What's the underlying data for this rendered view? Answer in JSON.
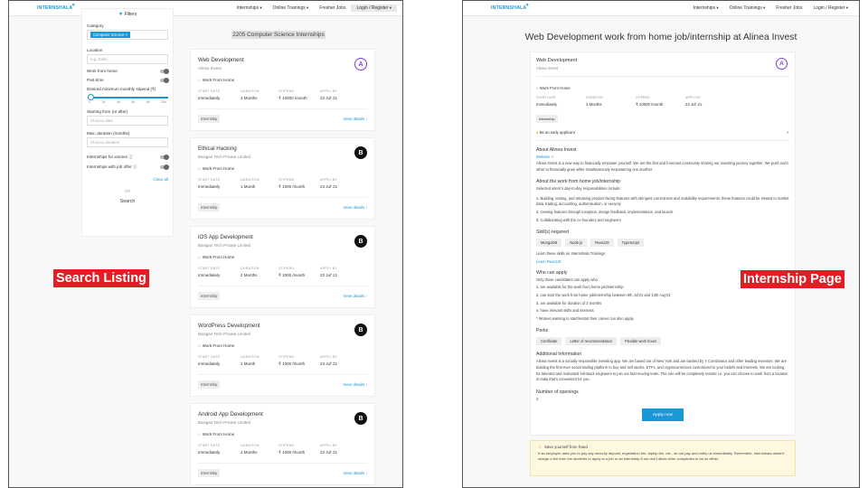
{
  "nav": {
    "logo": "INTERNSHALA",
    "items": [
      "Internships",
      "Online Trainings",
      "Fresher Jobs",
      "Login / Register"
    ]
  },
  "filters": {
    "title": "Filters",
    "category_label": "Category",
    "category_chip": "Computer Science",
    "location_label": "Location",
    "location_placeholder": "e.g. Delhi",
    "wfh": "Work from home",
    "parttime": "Part-time",
    "stipend_label": "Desired minimum monthly stipend (₹)",
    "ticks": [
      "0",
      "2k",
      "4k",
      "6k",
      "8k",
      "10k"
    ],
    "starting_label": "Starting from (or after)",
    "starting_placeholder": "Choose date",
    "duration_label": "Max. duration (months)",
    "duration_placeholder": "Choose duration",
    "women": "Internships for women",
    "joboffer": "Internships with job offer",
    "clear": "Clear all",
    "or": "OR",
    "search": "Search"
  },
  "listing": {
    "header": "2205 Computer Science Internships",
    "meta_heads": [
      "START DATE",
      "DURATION",
      "STIPEND",
      "APPLY BY"
    ],
    "wfh": "Work From Home",
    "tag": "Internship",
    "view": "View details",
    "cards": [
      {
        "title": "Web Development",
        "company": "Alinea Invest",
        "logo": "A",
        "start": "Immediately",
        "duration": "3 Months",
        "stipend": "₹ 10000 /month",
        "apply": "23 Jul' 21"
      },
      {
        "title": "Ethical Hacking",
        "company": "Basigan Tech Private Limited",
        "logo": "B",
        "start": "Immediately",
        "duration": "1 Month",
        "stipend": "₹ 1000 /month",
        "apply": "23 Jul' 21"
      },
      {
        "title": "iOS App Development",
        "company": "Basigan Tech Private Limited",
        "logo": "B",
        "start": "Immediately",
        "duration": "2 Months",
        "stipend": "₹ 1000 /month",
        "apply": "23 Jul' 21"
      },
      {
        "title": "WordPress Development",
        "company": "Basigan Tech Private Limited",
        "logo": "B",
        "start": "Immediately",
        "duration": "1 Month",
        "stipend": "₹ 1000 /month",
        "apply": "23 Jul' 21"
      },
      {
        "title": "Android App Development",
        "company": "Basigan Tech Private Limited",
        "logo": "B",
        "start": "Immediately",
        "duration": "2 Months",
        "stipend": "₹ 1000 /month",
        "apply": "23 Jul' 21"
      }
    ]
  },
  "labels": {
    "left": "Search Listing",
    "right": "Internship Page"
  },
  "detail": {
    "page_title": "Web Development work from home job/internship at Alinea Invest",
    "job_title": "Web Development",
    "company": "Alinea Invest",
    "logo": "A",
    "wfh": "Work From Home",
    "start": "Immediately",
    "duration": "3 Months",
    "stipend": "₹ 10000 /month",
    "apply": "23 Jul' 21",
    "tag": "Internship",
    "early": "Be an early applicant",
    "about_company_h": "About Alinea Invest",
    "website": "Website",
    "about_company": "Alinea Invest is a new way to financially empower yourself. We are the first and foremost community sharing our investing journey together. We push each other to financially grow while simultaneously empowering one another.",
    "about_work_h": "About the work from home job/internship",
    "about_work_intro": "Selected intern's day-to-day responsibilities include:",
    "resp": [
      "1. Building, testing, and releasing product-facing features with stringent correctness and scalability requirements; these features could be related to market data, trading, accounting, authentication, or security",
      "2. Owning features through inception, design feedback, implementation, and launch",
      "3. Collaborating with the co-founders and engineers"
    ],
    "skills_h": "Skill(s) required",
    "skills": [
      "MongoDB",
      "Node.js",
      "ReactJS",
      "TypeScript"
    ],
    "learn_text": "Learn these skills on Internshala Trainings",
    "learn_link": "Learn ReactJS",
    "who_h": "Who can apply",
    "who_intro": "Only those candidates can apply who:",
    "who": [
      "1. are available for the work from home job/internship",
      "2. can start the work from home job/internship between 9th Jul'21 and 13th Aug'21",
      "3. are available for duration of 3 months",
      "4. have relevant skills and interests",
      "* Women wanting to start/restart their career can also apply."
    ],
    "perks_h": "Perks",
    "perks": [
      "Certificate",
      "Letter of recommendation",
      "Flexible work hours"
    ],
    "add_h": "Additional Information",
    "add_text": "Alinea Invest is a socially responsible investing app. We are based out of New York and are backed by Y Combinator and other leading investors. We are building the first-ever social trading platform to buy and sell stocks, ETFs, and cryptocurrencies customized to your beliefs and interests. We are looking for talented and motivated full-stack engineers to join our fast-moving team. The role will be completely remote i.e. you can choose to work from a location in India that's convenient for you.",
    "openings_h": "Number of openings",
    "openings": "2",
    "apply_btn": "Apply now",
    "fraud_title": "Save yourself from fraud",
    "fraud_text": "If an employer asks you to pay any security deposit, registration fee, laptop fee, etc., do not pay and notify us immediately. Remember, Internshala doesn't charge a fee from the students to apply to a job or an internship & we don't allow other companies to do so either."
  }
}
